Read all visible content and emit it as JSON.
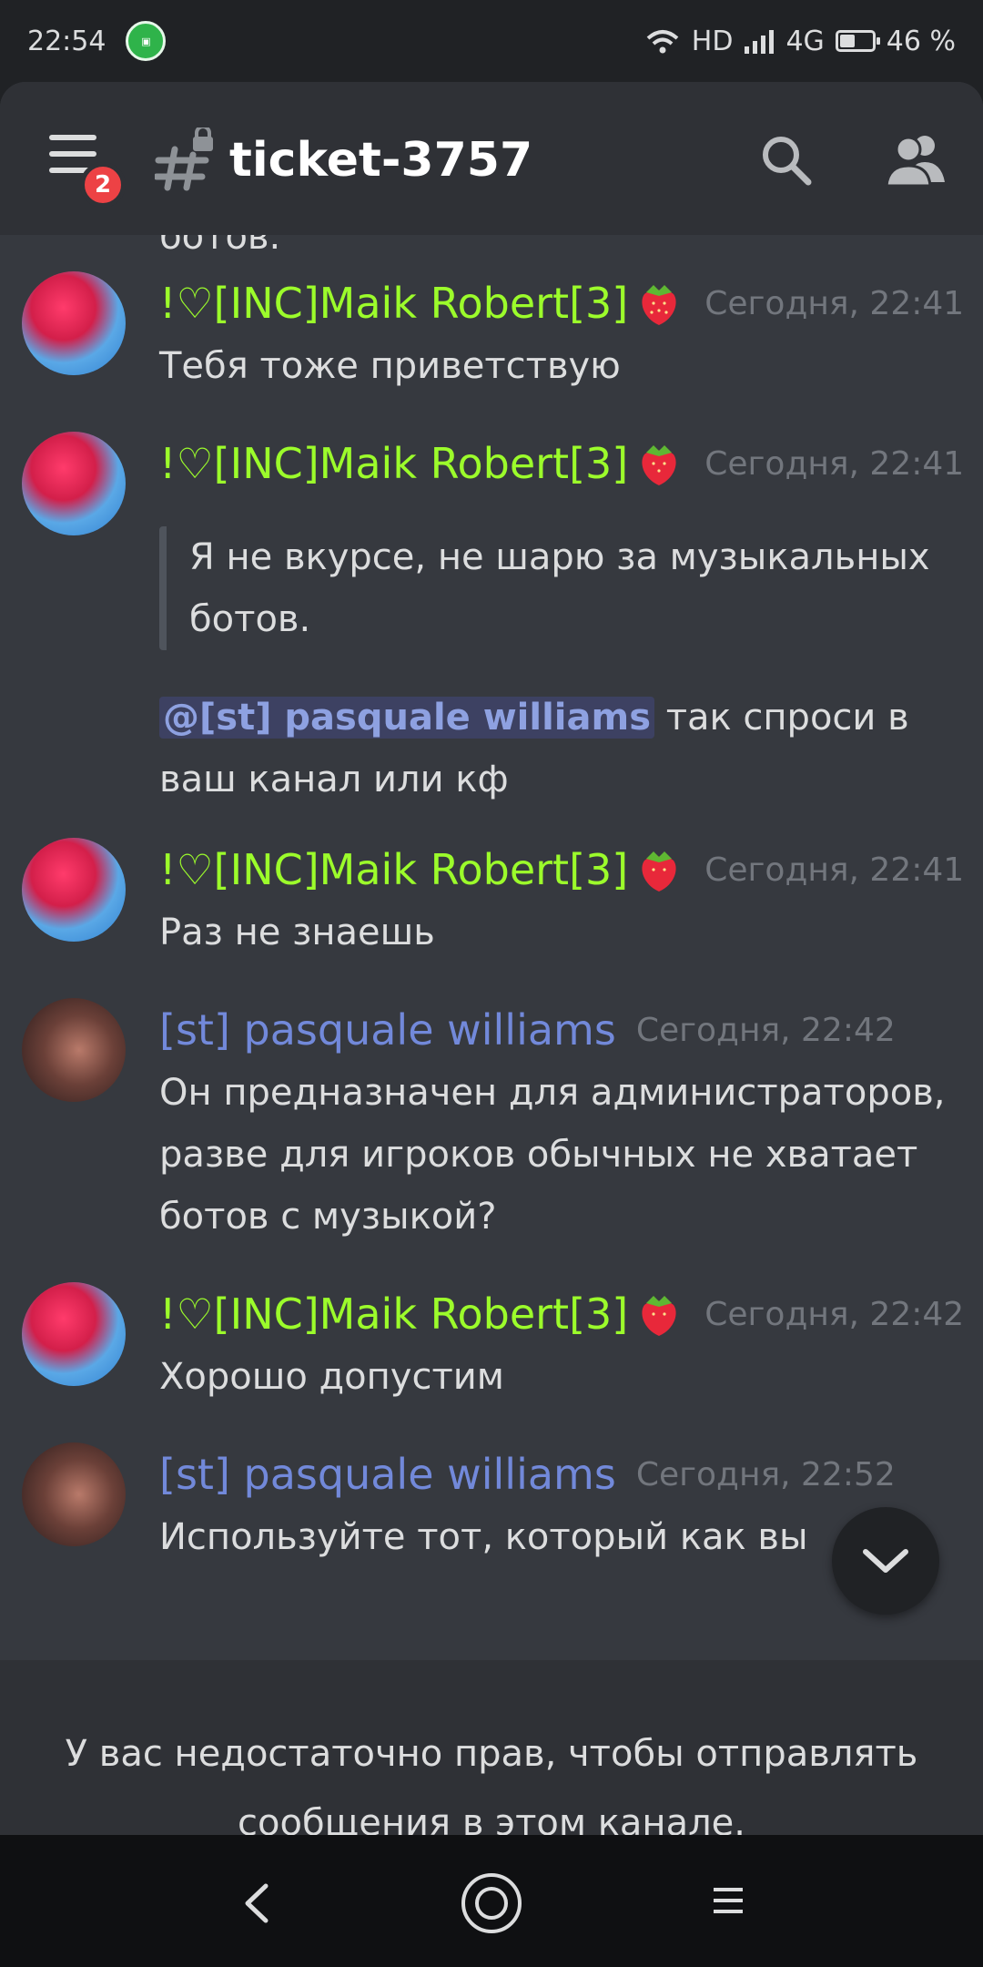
{
  "status_bar": {
    "time": "22:54",
    "network": "HD",
    "signal_type": "4G",
    "battery_percent_text": "46 %",
    "battery_level": 0.46
  },
  "header": {
    "channel_name": "ticket-3757",
    "menu_badge_count": "2"
  },
  "messages": [
    {
      "author": "!♡[INC]Maik Robert[3]",
      "timestamp": "Сегодня, 22:41",
      "text": "Тебя тоже приветствую"
    },
    {
      "author": "!♡[INC]Maik Robert[3]",
      "timestamp": "Сегодня, 22:41",
      "quote": "Я не вкурсе, не шарю за музыкальных ботов.",
      "mention": "@[st] pasquale williams",
      "text": "так спроси в ваш канал или кф"
    },
    {
      "author": "!♡[INC]Maik Robert[3]",
      "timestamp": "Сегодня, 22:41",
      "text": "Раз не знаешь"
    },
    {
      "author": "[st] pasquale williams",
      "timestamp": "Сегодня, 22:42",
      "text": "Он предназначен для администраторов, разве для игроков обычных не хватает ботов с музыкой?"
    },
    {
      "author": "!♡[INC]Maik Robert[3]",
      "timestamp": "Сегодня, 22:42",
      "text": "Хорошо допустим"
    },
    {
      "author": "[st] pasquale williams",
      "timestamp": "Сегодня, 22:52",
      "text": "Используйте тот, который как вы"
    }
  ],
  "partial_top_text": "ботов.",
  "notice": {
    "text": "У вас недостаточно прав, чтобы отправлять сообщения в этом канале."
  },
  "colors": {
    "maik_name": "#9cfc2b",
    "pasquale_name": "#7289da",
    "background": "#36393f",
    "badge": "#ed4245"
  }
}
